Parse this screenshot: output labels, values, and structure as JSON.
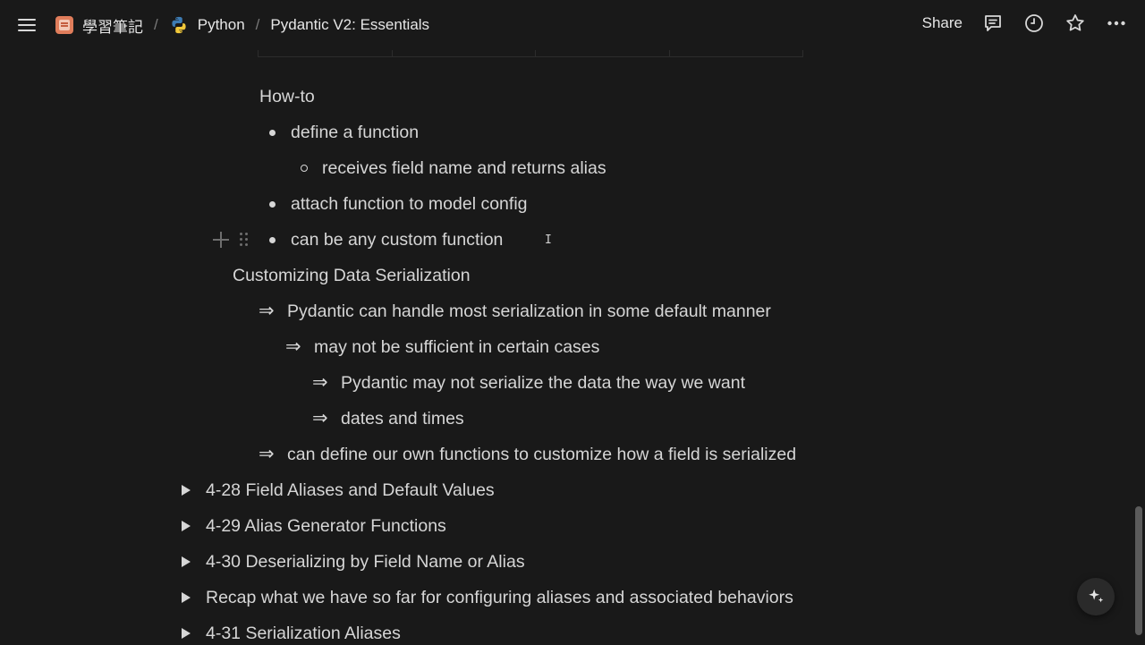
{
  "breadcrumb": {
    "workspace": "學習筆記",
    "parent": "Python",
    "current": "Pydantic V2: Essentials"
  },
  "topbar": {
    "share_label": "Share",
    "icons": [
      "comment-icon",
      "history-icon",
      "star-icon",
      "more-icon"
    ]
  },
  "content": {
    "howto_heading": "How-to",
    "bullets": {
      "b1": "define a function",
      "b1_sub": "receives field name and returns alias",
      "b2": "attach function to model config",
      "b3": "can be any custom function"
    },
    "serialization_heading": "Customizing Data Serialization",
    "arrow_symbol": "⇒",
    "arrows": {
      "a1": "Pydantic can handle most serialization in some default manner",
      "a2": "may not be sufficient in certain cases",
      "a3": "Pydantic may not serialize the data the way we want",
      "a4": "dates and times",
      "a5": "can define our own functions to customize how a field is serialized"
    },
    "toggles": {
      "t1": "4-28 Field Aliases and Default Values",
      "t2": "4-29 Alias Generator Functions",
      "t3": "4-30 Deserializing by Field Name or Alias",
      "t4": "Recap what we have so far for configuring aliases and associated behaviors",
      "t5": "4-31 Serialization Aliases"
    }
  },
  "colors": {
    "background": "#191919",
    "text": "#d6d6d6",
    "muted": "#6e6e6e"
  }
}
